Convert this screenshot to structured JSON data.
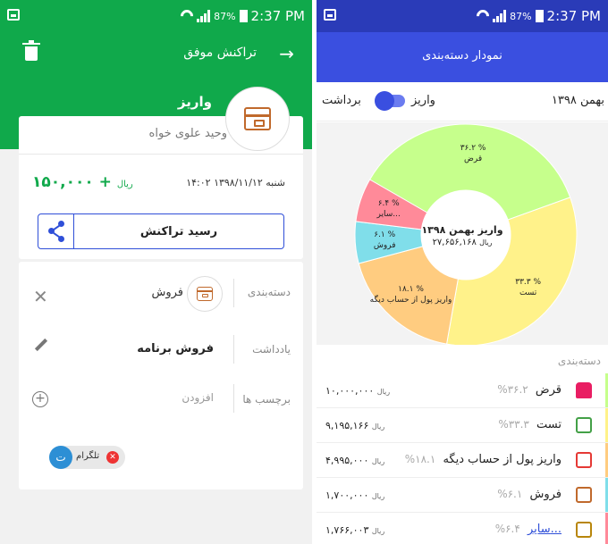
{
  "status": {
    "battery": "87%",
    "time": "2:37 PM"
  },
  "left": {
    "title": "تراکنش موفق",
    "type": "واریز",
    "person": "وحید علوی خواه",
    "amount": "+ ۱۵۰,۰۰۰",
    "currency": "ریال",
    "datetime": "شنبه ۱۳۹۸/۱۱/۱۲ ۱۴:۰۲",
    "receipt_label": "رسید تراکنش",
    "category_label": "دسته‌بندی",
    "category_value": "فروش",
    "note_label": "یادداشت",
    "note_value": "فروش برنامه",
    "tags_label": "برچسب ها",
    "tags_add": "افزودن",
    "chip_letter": "ت",
    "chip_label": "تلگرام",
    "colors": {
      "green": "#10a94b",
      "blue": "#2f4fd8"
    }
  },
  "right": {
    "title": "نمودار دسته‌بندی",
    "month": "بهمن ۱۳۹۸",
    "deposit": "واریز",
    "withdraw": "برداشت",
    "center_title": "واریز بهمن ۱۳۹۸",
    "center_amount": "۲۷,۶۵۶,۱۶۸",
    "center_currency": "ریال",
    "section_title": "دسته‌بندی",
    "colors": {
      "blue": "#3a4fe0"
    },
    "chart_data": {
      "type": "pie",
      "title": "واریز بهمن ۱۳۹۸",
      "categories": [
        "قرض",
        "تست",
        "واریز پول از حساب دیگه",
        "فروش",
        "سایر..."
      ],
      "values": [
        36.2,
        33.3,
        18.1,
        6.1,
        6.4
      ],
      "labels": [
        "۳۶.۲ %\nقرض",
        "۳۳.۳ %\nتست",
        "۱۸.۱ %\nواریز پول از حساب دیگه",
        "۶.۱ %\nفروش",
        "۶.۴ %\nسایر..."
      ],
      "colors": [
        "#c6ff8c",
        "#fff28a",
        "#ffcc80",
        "#80deea",
        "#ff8a99"
      ]
    },
    "items": [
      {
        "name": "قرض",
        "pct": "%۳۶.۲",
        "value": "۱۰,۰۰۰,۰۰۰",
        "currency": "ریال",
        "icon": "tshirt-icon",
        "color": "#e91e63",
        "stripe": "#c6ff8c"
      },
      {
        "name": "تست",
        "pct": "%۳۳.۳",
        "value": "۹,۱۹۵,۱۶۶",
        "currency": "ریال",
        "icon": "money-icon",
        "color": "#43a047",
        "stripe": "#fff28a"
      },
      {
        "name": "واریز پول از حساب دیگه",
        "pct": "%۱۸.۱",
        "value": "۴,۹۹۵,۰۰۰",
        "currency": "ریال",
        "icon": "restaurant-icon",
        "color": "#e53935",
        "stripe": "#ffcc80"
      },
      {
        "name": "فروش",
        "pct": "%۶.۱",
        "value": "۱,۷۰۰,۰۰۰",
        "currency": "ریال",
        "icon": "box-icon",
        "color": "#c0692c",
        "stripe": "#80deea"
      },
      {
        "name": "سایر...",
        "pct": "%۶.۴",
        "value": "۱,۷۶۶,۰۰۳",
        "currency": "ریال",
        "icon": "door-icon",
        "color": "#b8860b",
        "stripe": "#ff8a99"
      }
    ]
  }
}
